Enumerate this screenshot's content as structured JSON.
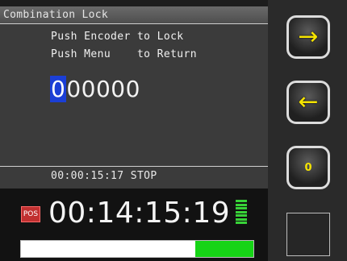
{
  "screen": {
    "title": "Combination Lock",
    "instruction_lines": [
      "Push Encoder to Lock",
      "Push Menu    to Return"
    ],
    "code": {
      "selected_digit": "0",
      "rest": "00000"
    },
    "small_timecode": "00:00:15:17 STOP"
  },
  "transport": {
    "pos_badge": "POS",
    "timecode": "00:14:15:19",
    "progress_fraction": 0.25
  },
  "side_buttons": [
    {
      "label": "→",
      "icon": "right-arrow-icon"
    },
    {
      "label": "←",
      "icon": "left-arrow-icon"
    },
    {
      "label": "0",
      "icon": "zero-icon"
    }
  ],
  "colors": {
    "accent_yellow": "#f5e400",
    "selection_blue": "#1b3fd6",
    "progress_green": "#16d416",
    "pos_red": "#c03030"
  }
}
